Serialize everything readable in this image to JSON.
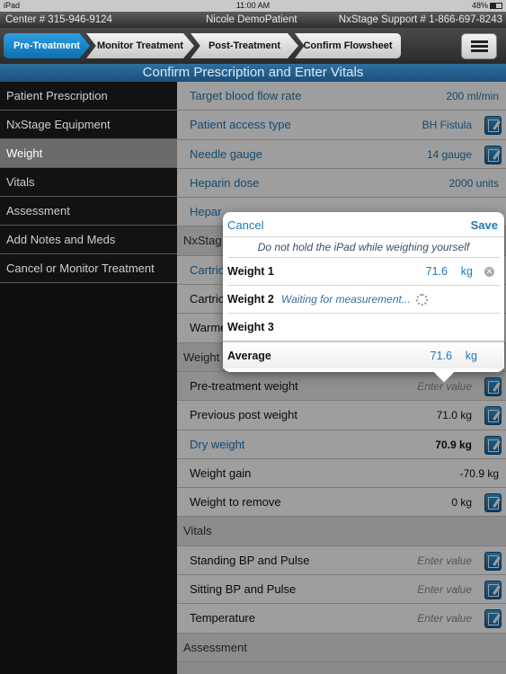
{
  "status_bar": {
    "device": "iPad",
    "time": "11:00 AM",
    "battery": "48%"
  },
  "info_bar": {
    "center": "Center # 315-946-9124",
    "patient": "Nicole DemoPatient",
    "support": "NxStage Support # 1-866-697-8243"
  },
  "steps": [
    "Pre-Treatment",
    "Monitor Treatment",
    "Post-Treatment",
    "Confirm Flowsheet"
  ],
  "page_title": "Confirm Prescription and Enter Vitals",
  "sidebar": {
    "items": [
      "Patient Prescription",
      "NxStage Equipment",
      "Weight",
      "Vitals",
      "Assessment",
      "Add Notes and Meds",
      "Cancel or Monitor Treatment"
    ],
    "selected": "Weight"
  },
  "main": {
    "prescription_rows": [
      {
        "label": "Target blood flow rate",
        "value": "200 ml/min"
      },
      {
        "label": "Patient access type",
        "value": "BH Fistula"
      },
      {
        "label": "Needle gauge",
        "value": "14 gauge"
      },
      {
        "label": "Heparin dose",
        "value": "2000 units"
      },
      {
        "label": "Hepar",
        "value": ""
      }
    ],
    "equipment_section": "NxStag",
    "equipment_rows": [
      {
        "label": "Cartric"
      },
      {
        "label": "Cartric"
      },
      {
        "label": "Warme"
      }
    ],
    "weight_section": "Weight",
    "weight_rows": [
      {
        "label": "Pre-treatment weight",
        "value": "Enter value"
      },
      {
        "label": "Previous post weight",
        "value": "71.0 kg"
      },
      {
        "label": "Dry weight",
        "value": "70.9 kg"
      },
      {
        "label": "Weight gain",
        "value": "-70.9 kg"
      },
      {
        "label": "Weight to remove",
        "value": "0 kg"
      }
    ],
    "vitals_section": "Vitals",
    "vitals_rows": [
      {
        "label": "Standing BP and Pulse",
        "value": "Enter value"
      },
      {
        "label": "Sitting BP and Pulse",
        "value": "Enter value"
      },
      {
        "label": "Temperature",
        "value": "Enter value"
      }
    ],
    "assessment_section": "Assessment"
  },
  "popover": {
    "cancel": "Cancel",
    "save": "Save",
    "note": "Do not hold the iPad while weighing yourself",
    "weight1": {
      "label": "Weight 1",
      "value": "71.6",
      "unit": "kg"
    },
    "weight2": {
      "label": "Weight 2",
      "status": "Waiting for measurement..."
    },
    "weight3": {
      "label": "Weight 3"
    },
    "average": {
      "label": "Average",
      "value": "71.6",
      "unit": "kg"
    }
  },
  "colors": {
    "accent": "#1f78b4",
    "title_bar": "#1b4f7b",
    "active_step": "#1a86cc"
  }
}
